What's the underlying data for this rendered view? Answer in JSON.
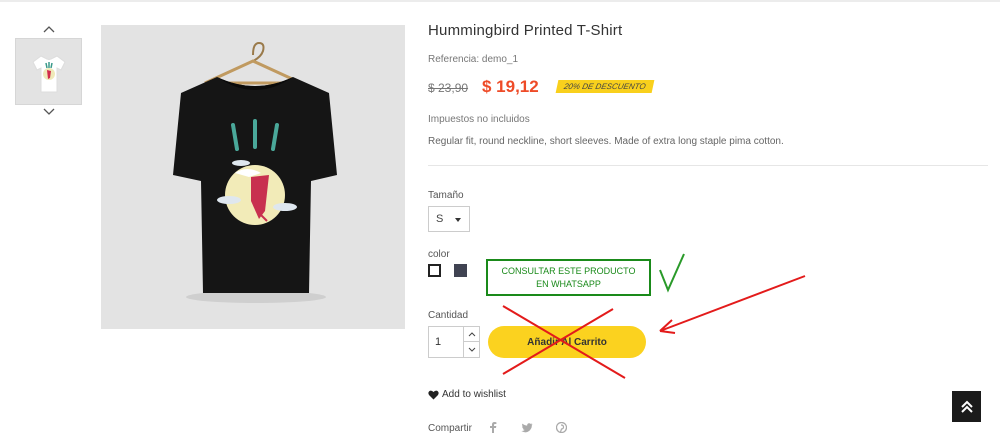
{
  "product": {
    "title": "Hummingbird Printed T-Shirt",
    "reference_label": "Referencia:",
    "reference_value": "demo_1",
    "old_price": "$ 23,90",
    "new_price": "$ 19,12",
    "discount_badge": "20% DE DESCUENTO",
    "tax_note": "Impuestos no incluidos",
    "description": "Regular fit, round neckline, short sleeves. Made of extra long staple pima cotton."
  },
  "options": {
    "size_label": "Tamaño",
    "size_value": "S",
    "color_label": "color",
    "colors": [
      "#ffffff",
      "#404352"
    ]
  },
  "whatsapp": {
    "line1": "CONSULTAR ESTE PRODUCTO",
    "line2": "EN WHATSAPP"
  },
  "cart": {
    "quantity_label": "Cantidad",
    "quantity_value": "1",
    "add_to_cart": "Añadir Al Carrito"
  },
  "wishlist_label": "Add to wishlist",
  "share_label": "Compartir",
  "social_icons": [
    "facebook-icon",
    "twitter-icon",
    "pinterest-icon"
  ],
  "colors": {
    "price": "#ee4b28",
    "badge": "#f9d01c",
    "cart_button": "#fbd21f",
    "annotation_green": "#1a8a1a",
    "annotation_red": "#e31b1b"
  }
}
